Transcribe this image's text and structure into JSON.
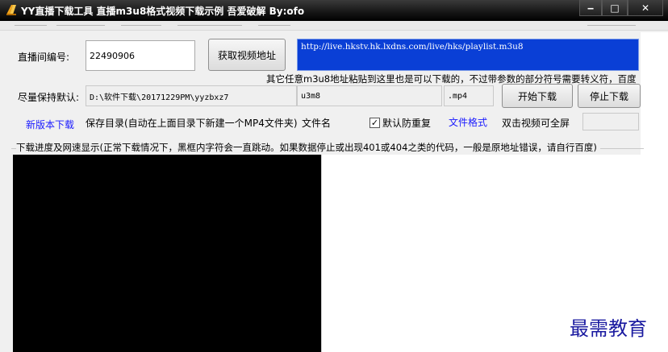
{
  "window": {
    "title": "YY直播下载工具 直播m3u8格式视频下载示例 吾爱破解 By:ofo",
    "minimize_glyph": "‒",
    "maximize_glyph": "□",
    "close_glyph": "✕"
  },
  "room": {
    "label": "直播间编号:",
    "value": "22490906",
    "fetch_button": "获取视频地址"
  },
  "url": {
    "value": "http://live.hkstv.hk.lxdns.com/live/hks/playlist.m3u8",
    "hint": "其它任意m3u8地址粘贴到这里也是可以下载的，不过带参数的部分符号需要转义符，百度"
  },
  "save": {
    "label": "尽量保持默认:",
    "directory": "D:\\软件下载\\20171229PM\\yyzbxz7",
    "filename": "u3m8",
    "extension": ".mp4",
    "start_button": "开始下载",
    "stop_button": "停止下载"
  },
  "options": {
    "new_version_link": "新版本下载",
    "dir_caption": "保存目录(自动在上面目录下新建一个MP4文件夹)",
    "filename_caption": "文件名",
    "dedupe_label": "默认防重复",
    "dedupe_checked": "✓",
    "format_link": "文件格式",
    "fullscreen_hint": "双击视频可全屏"
  },
  "progress": {
    "label": "下载进度及网速显示(正常下载情况下，黑框内字符会一直跳动。如果数据停止或出现401或404之类的代码，一般是原地址错误，请自行百度)"
  },
  "watermark": {
    "text": "最需教育"
  },
  "colors": {
    "url_bg": "#0a3fd6",
    "link_blue": "#1a1aff",
    "console_bg": "#000000"
  }
}
